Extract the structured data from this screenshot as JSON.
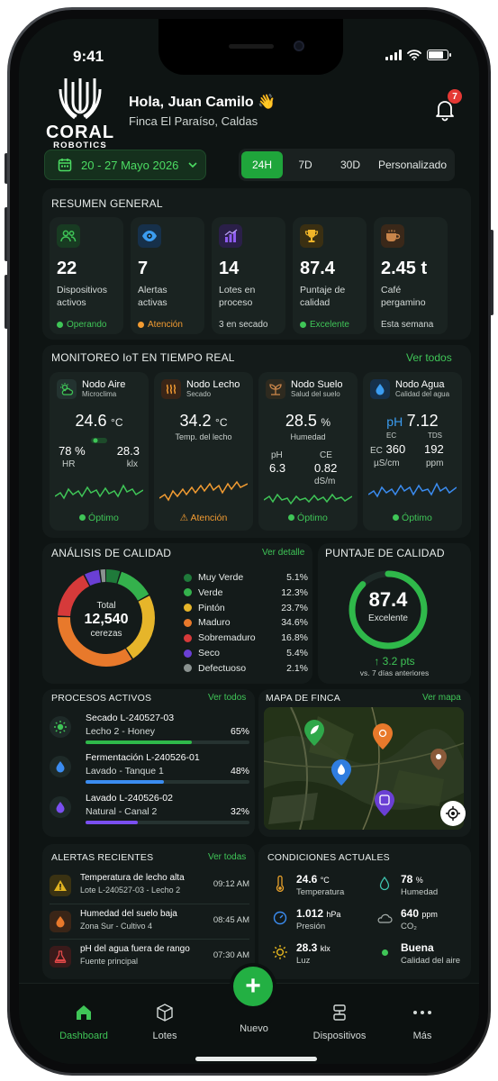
{
  "status": {
    "time": "9:41"
  },
  "brand": {
    "name": "CORAL",
    "sub": "ROBOTICS"
  },
  "header": {
    "greeting": "Hola, Juan Camilo 👋",
    "farm": "Finca El Paraíso, Caldas",
    "notifications": "7"
  },
  "filters": {
    "date_range": "20 - 27 Mayo 2026",
    "options": [
      "24H",
      "7D",
      "30D",
      "Personalizado"
    ],
    "selected": "24H"
  },
  "summary": {
    "title": "RESUMEN GENERAL",
    "items": [
      {
        "icon": "users-icon",
        "value": "22",
        "label": "Dispositivos activos",
        "status": "Operando",
        "status_color": "#3fc557",
        "icon_color": "#3fc557"
      },
      {
        "icon": "eye-icon",
        "value": "7",
        "label": "Alertas activas",
        "status": "Atención",
        "status_color": "#f39c32",
        "icon_color": "#3b9cf0"
      },
      {
        "icon": "bar-chart-icon",
        "value": "14",
        "label": "Lotes en proceso",
        "status": "3 en secado",
        "status_color": "#d0d6d4",
        "icon_color": "#8e5cf0"
      },
      {
        "icon": "trophy-icon",
        "value": "87.4",
        "label": "Puntaje de calidad",
        "status": "Excelente",
        "status_color": "#3fc557",
        "icon_color": "#f0b429"
      },
      {
        "icon": "coffee-icon",
        "value": "2.45 t",
        "label": "Café pergamino",
        "status": "Esta semana",
        "status_color": "#d0d6d4",
        "icon_color": "#c9854a"
      }
    ]
  },
  "iot": {
    "title": "MONITOREO IoT EN TIEMPO REAL",
    "link": "Ver todos",
    "nodes": [
      {
        "name": "Nodo Aire",
        "sub": "Microclima",
        "main": "24.6",
        "unit": "°C",
        "a_val": "78 %",
        "a_lbl": "HR",
        "b_val": "28.3",
        "b_lbl": "klx",
        "status": "Óptimo",
        "color": "#3fc557"
      },
      {
        "name": "Nodo Lecho",
        "sub": "Secado",
        "main": "34.2",
        "unit": "°C",
        "a_lbl": "Temp. del lecho",
        "status": "Atención",
        "color": "#f39c32"
      },
      {
        "name": "Nodo Suelo",
        "sub": "Salud del suelo",
        "main": "28.5",
        "unit": "%",
        "a_lbl": "Humedad",
        "ph_lbl": "pH",
        "ph_val": "6.3",
        "ce_lbl": "CE",
        "ce_val": "0.82",
        "ce_unit": "dS/m",
        "status": "Óptimo",
        "color": "#3fc557"
      },
      {
        "name": "Nodo Agua",
        "sub": "Calidad del agua",
        "ph_lbl": "pH",
        "main": "7.12",
        "ec_lbl": "EC",
        "ec_val": "360",
        "ec_unit": "µS/cm",
        "tds_lbl": "TDS",
        "tds_val": "192",
        "tds_unit": "ppm",
        "status": "Óptimo",
        "color": "#3b8cf0"
      }
    ]
  },
  "quality": {
    "title": "ANÁLISIS DE CALIDAD",
    "link": "Ver detalle",
    "total_label": "Total",
    "total": "12,540",
    "unit": "cerezas",
    "legend": [
      {
        "name": "Muy Verde",
        "pct": "5.1%",
        "value": 5.1,
        "color": "#1f7a3a"
      },
      {
        "name": "Verde",
        "pct": "12.3%",
        "value": 12.3,
        "color": "#34b14c"
      },
      {
        "name": "Pintón",
        "pct": "23.7%",
        "value": 23.7,
        "color": "#e6b52a"
      },
      {
        "name": "Maduro",
        "pct": "34.6%",
        "value": 34.6,
        "color": "#e8792b"
      },
      {
        "name": "Sobremaduro",
        "pct": "16.8%",
        "value": 16.8,
        "color": "#d63a3a"
      },
      {
        "name": "Seco",
        "pct": "5.4%",
        "value": 5.4,
        "color": "#6a3fd4"
      },
      {
        "name": "Defectuoso",
        "pct": "2.1%",
        "value": 2.1,
        "color": "#8a9290"
      }
    ]
  },
  "score": {
    "title": "PUNTAJE DE CALIDAD",
    "value": "87.4",
    "label": "Excelente",
    "delta": "↑ 3.2 pts",
    "delta_sub": "vs. 7 días anteriores",
    "fraction": 0.874
  },
  "processes": {
    "title": "PROCESOS ACTIVOS",
    "link": "Ver todos",
    "items": [
      {
        "title": "Secado L-240527-03",
        "sub": "Lecho 2 - Honey",
        "pct": "65%",
        "value": 65,
        "color": "#2fb84a",
        "icon": "sun-icon"
      },
      {
        "title": "Fermentación L-240526-01",
        "sub": "Lavado - Tanque 1",
        "pct": "48%",
        "value": 48,
        "color": "#3b8cf0",
        "icon": "drop-icon"
      },
      {
        "title": "Lavado L-240526-02",
        "sub": "Natural - Canal 2",
        "pct": "32%",
        "value": 32,
        "color": "#7a4ff0",
        "icon": "drop-icon"
      }
    ]
  },
  "map": {
    "title": "MAPA DE FINCA",
    "link": "Ver mapa"
  },
  "alerts": {
    "title": "ALERTAS RECIENTES",
    "link": "Ver todas",
    "items": [
      {
        "title": "Temperatura de lecho alta",
        "sub": "Lote L-240527-03 - Lecho 2",
        "time": "09:12 AM",
        "color": "#e0b320",
        "icon": "warning-icon"
      },
      {
        "title": "Humedad del suelo baja",
        "sub": "Zona Sur - Cultivo 4",
        "time": "08:45 AM",
        "color": "#e8792b",
        "icon": "drop-icon"
      },
      {
        "title": "pH del agua fuera de rango",
        "sub": "Fuente principal",
        "time": "07:30 AM",
        "color": "#e04848",
        "icon": "flask-icon"
      }
    ]
  },
  "conditions": {
    "title": "CONDICIONES ACTUALES",
    "items": [
      {
        "value": "24.6",
        "unit": "°C",
        "label": "Temperatura",
        "icon": "thermometer-icon"
      },
      {
        "value": "78",
        "unit": "%",
        "label": "Humedad",
        "icon": "drop-icon"
      },
      {
        "value": "1.012",
        "unit": "hPa",
        "label": "Presión",
        "icon": "gauge-icon"
      },
      {
        "value": "640",
        "unit": "ppm",
        "label": "CO₂",
        "icon": "co2-icon"
      },
      {
        "value": "28.3",
        "unit": "klx",
        "label": "Luz",
        "icon": "sun-icon"
      },
      {
        "value": "Buena",
        "unit": "",
        "label": "Calidad del aire",
        "icon": "leaf-icon"
      }
    ]
  },
  "nav": {
    "items": [
      {
        "label": "Dashboard",
        "icon": "home-icon",
        "active": true
      },
      {
        "label": "Lotes",
        "icon": "box-icon"
      },
      {
        "label": "Nuevo",
        "icon": "plus-icon"
      },
      {
        "label": "Dispositivos",
        "icon": "devices-icon"
      },
      {
        "label": "Más",
        "icon": "more-icon"
      }
    ]
  }
}
